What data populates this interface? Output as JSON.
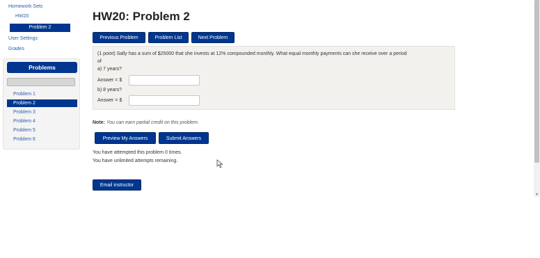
{
  "nav": {
    "homework_sets": "Homework Sets",
    "hw": "HW20",
    "current_problem": "Problem 2",
    "user_settings": "User Settings",
    "grades": "Grades"
  },
  "problems_panel": {
    "header": "Problems",
    "items": [
      "Problem 1",
      "Problem 2",
      "Problem 3",
      "Problem 4",
      "Problem 5",
      "Problem 6"
    ],
    "active_index": 1
  },
  "main": {
    "title": "HW20: Problem 2",
    "buttons": {
      "previous": "Previous Problem",
      "list": "Problem List",
      "next": "Next Problem"
    },
    "problem": {
      "line1": "(1 point) Sally has a sum of $25000 that she invests at 12% compounded monthly. What equal monthly payments can she receive over a period",
      "line2": "of",
      "part_a": "a) 7 years?",
      "answer_label_a": "Answer = $",
      "part_b": "b) 8 years?",
      "answer_label_b": "Answer = $",
      "answer_a_value": "",
      "answer_b_value": ""
    },
    "note_label": "Note:",
    "note_text": "You can earn partial credit on this problem.",
    "preview_button": "Preview My Answers",
    "submit_button": "Submit Answers",
    "attempts": "You have attempted this problem 0 times.",
    "remaining": "You have unlimited attempts remaining.",
    "email_button": "Email instructor"
  },
  "colors": {
    "accent": "#00368f",
    "link": "#2a5db0",
    "problem_bg": "#f3f1ee"
  }
}
